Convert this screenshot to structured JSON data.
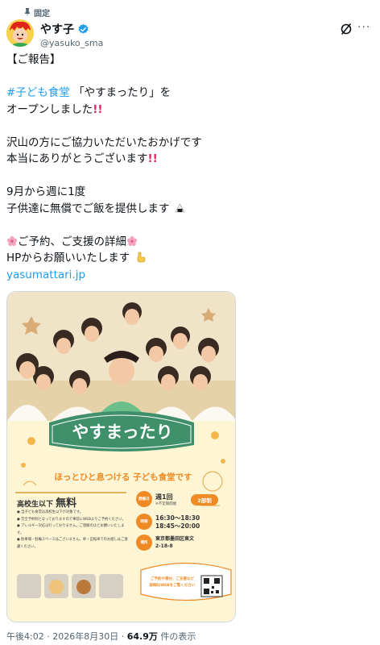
{
  "pinned": {
    "label": "固定"
  },
  "author": {
    "display_name": "やす子",
    "handle": "@yasuko_sma",
    "verified": true
  },
  "tweet": {
    "l1": "【ご報告】",
    "hashtag": "#子ども食堂",
    "l3_rest": " 「やすまったり」を",
    "l4": "オープンしました",
    "l6": "沢山の方にご協力いただいたおかげです",
    "l7": "本当にありがとうございます",
    "l9": "9月から週に1度",
    "l10": "子供達に無償でご飯を提供します",
    "l12": "ご予約、ご支援の詳細",
    "l13": "HPからお願いいたします",
    "link": "yasumattari.jp"
  },
  "poster": {
    "logo": "やすまったり",
    "logo_sub": "YASUMATTARI",
    "tagline": "ほっとひと息つける 子ども食堂です",
    "target_label": "高校生以下",
    "target_price": "無料",
    "notes": [
      "● 当子ども食堂は高校生以下が対象です。",
      "● 完全予約制となっておりますので事前にWEBよりご予約ください。",
      "● アレルギー対応は行っておりません。ご理解のほどお願いいたします。",
      "● 駐車場・駐輪スペースはございません。車・自転車でのお越しはご遠慮ください。"
    ],
    "day_label": "開催日",
    "day_value": "週1回",
    "day_note": "※不定期開催",
    "parts": "2部制",
    "time_label": "時間",
    "time_1": "16:30～18:30",
    "time_2": "18:45～20:00",
    "place_label": "場所",
    "place_1": "東京都墨田区東文",
    "place_2": "2-18-8",
    "bubble_1": "ご予約や寄付、ご支援など",
    "bubble_2": "詳細はWEBをご覧ください"
  },
  "meta": {
    "time": "午後4:02",
    "date": "2026年8月30日",
    "views": "64.9万",
    "views_suffix": " 件の表示"
  },
  "colors": {
    "link": "#1d9bf0",
    "verified": "#1d9bf0",
    "poster_green": "#3f8f6b",
    "poster_orange": "#f08a24"
  }
}
